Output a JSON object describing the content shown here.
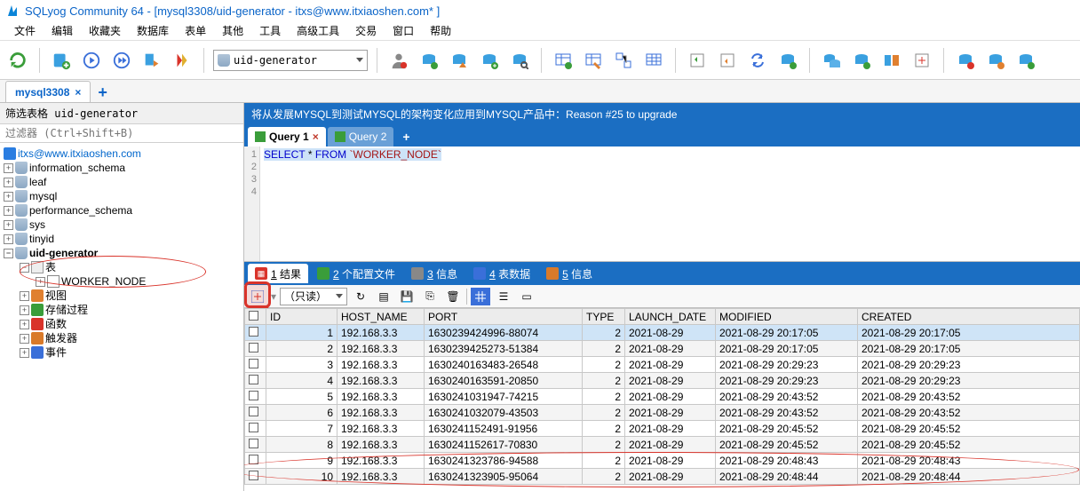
{
  "title": "SQLyog Community 64 - [mysql3308/uid-generator - itxs@www.itxiaoshen.com* ]",
  "menu": [
    "文件",
    "编辑",
    "收藏夹",
    "数据库",
    "表单",
    "其他",
    "工具",
    "高级工具",
    "交易",
    "窗口",
    "帮助"
  ],
  "db_selector": "uid-generator",
  "conn_tab": "mysql3308",
  "sidebar": {
    "header": "筛选表格 uid-generator",
    "filter_placeholder": "过滤器 (Ctrl+Shift+B)",
    "server": "itxs@www.itxiaoshen.com",
    "dbs": [
      "information_schema",
      "leaf",
      "mysql",
      "performance_schema",
      "sys",
      "tinyid"
    ],
    "active_db": "uid-generator",
    "table_group": "表",
    "table": "WORKER_NODE",
    "groups": [
      {
        "icon": "view",
        "label": "视图"
      },
      {
        "icon": "proc",
        "label": "存储过程"
      },
      {
        "icon": "func",
        "label": "函数"
      },
      {
        "icon": "trig",
        "label": "触发器"
      },
      {
        "icon": "event",
        "label": "事件"
      }
    ]
  },
  "banner": "将从发展MYSQL到测试MYSQL的架构变化应用到MYSQL产品中：Reason #25 to upgrade",
  "query_tabs": [
    "Query 1",
    "Query 2"
  ],
  "sql": {
    "kw1": "SELECT",
    "star": "*",
    "kw2": "FROM",
    "tbl": "`WORKER_NODE`"
  },
  "result_tabs": [
    {
      "n": "1",
      "label": "结果",
      "color": "#d9332a"
    },
    {
      "n": "2",
      "label": "个配置文件",
      "color": "#3a9d3a"
    },
    {
      "n": "3",
      "label": "信息",
      "color": "#888"
    },
    {
      "n": "4",
      "label": "表数据",
      "color": "#3a6fd9"
    },
    {
      "n": "5",
      "label": "信息",
      "color": "#d97a2a"
    }
  ],
  "readonly": "（只读）",
  "columns": [
    "",
    "ID",
    "HOST_NAME",
    "PORT",
    "TYPE",
    "LAUNCH_DATE",
    "MODIFIED",
    "CREATED"
  ],
  "rows": [
    {
      "id": 1,
      "host": "192.168.3.3",
      "port": "1630239424996-88074",
      "type": 2,
      "date": "2021-08-29",
      "mod": "2021-08-29 20:17:05",
      "cre": "2021-08-29 20:17:05"
    },
    {
      "id": 2,
      "host": "192.168.3.3",
      "port": "1630239425273-51384",
      "type": 2,
      "date": "2021-08-29",
      "mod": "2021-08-29 20:17:05",
      "cre": "2021-08-29 20:17:05"
    },
    {
      "id": 3,
      "host": "192.168.3.3",
      "port": "1630240163483-26548",
      "type": 2,
      "date": "2021-08-29",
      "mod": "2021-08-29 20:29:23",
      "cre": "2021-08-29 20:29:23"
    },
    {
      "id": 4,
      "host": "192.168.3.3",
      "port": "1630240163591-20850",
      "type": 2,
      "date": "2021-08-29",
      "mod": "2021-08-29 20:29:23",
      "cre": "2021-08-29 20:29:23"
    },
    {
      "id": 5,
      "host": "192.168.3.3",
      "port": "1630241031947-74215",
      "type": 2,
      "date": "2021-08-29",
      "mod": "2021-08-29 20:43:52",
      "cre": "2021-08-29 20:43:52"
    },
    {
      "id": 6,
      "host": "192.168.3.3",
      "port": "1630241032079-43503",
      "type": 2,
      "date": "2021-08-29",
      "mod": "2021-08-29 20:43:52",
      "cre": "2021-08-29 20:43:52"
    },
    {
      "id": 7,
      "host": "192.168.3.3",
      "port": "1630241152491-91956",
      "type": 2,
      "date": "2021-08-29",
      "mod": "2021-08-29 20:45:52",
      "cre": "2021-08-29 20:45:52"
    },
    {
      "id": 8,
      "host": "192.168.3.3",
      "port": "1630241152617-70830",
      "type": 2,
      "date": "2021-08-29",
      "mod": "2021-08-29 20:45:52",
      "cre": "2021-08-29 20:45:52"
    },
    {
      "id": 9,
      "host": "192.168.3.3",
      "port": "1630241323786-94588",
      "type": 2,
      "date": "2021-08-29",
      "mod": "2021-08-29 20:48:43",
      "cre": "2021-08-29 20:48:43"
    },
    {
      "id": 10,
      "host": "192.168.3.3",
      "port": "1630241323905-95064",
      "type": 2,
      "date": "2021-08-29",
      "mod": "2021-08-29 20:48:44",
      "cre": "2021-08-29 20:48:44"
    }
  ]
}
